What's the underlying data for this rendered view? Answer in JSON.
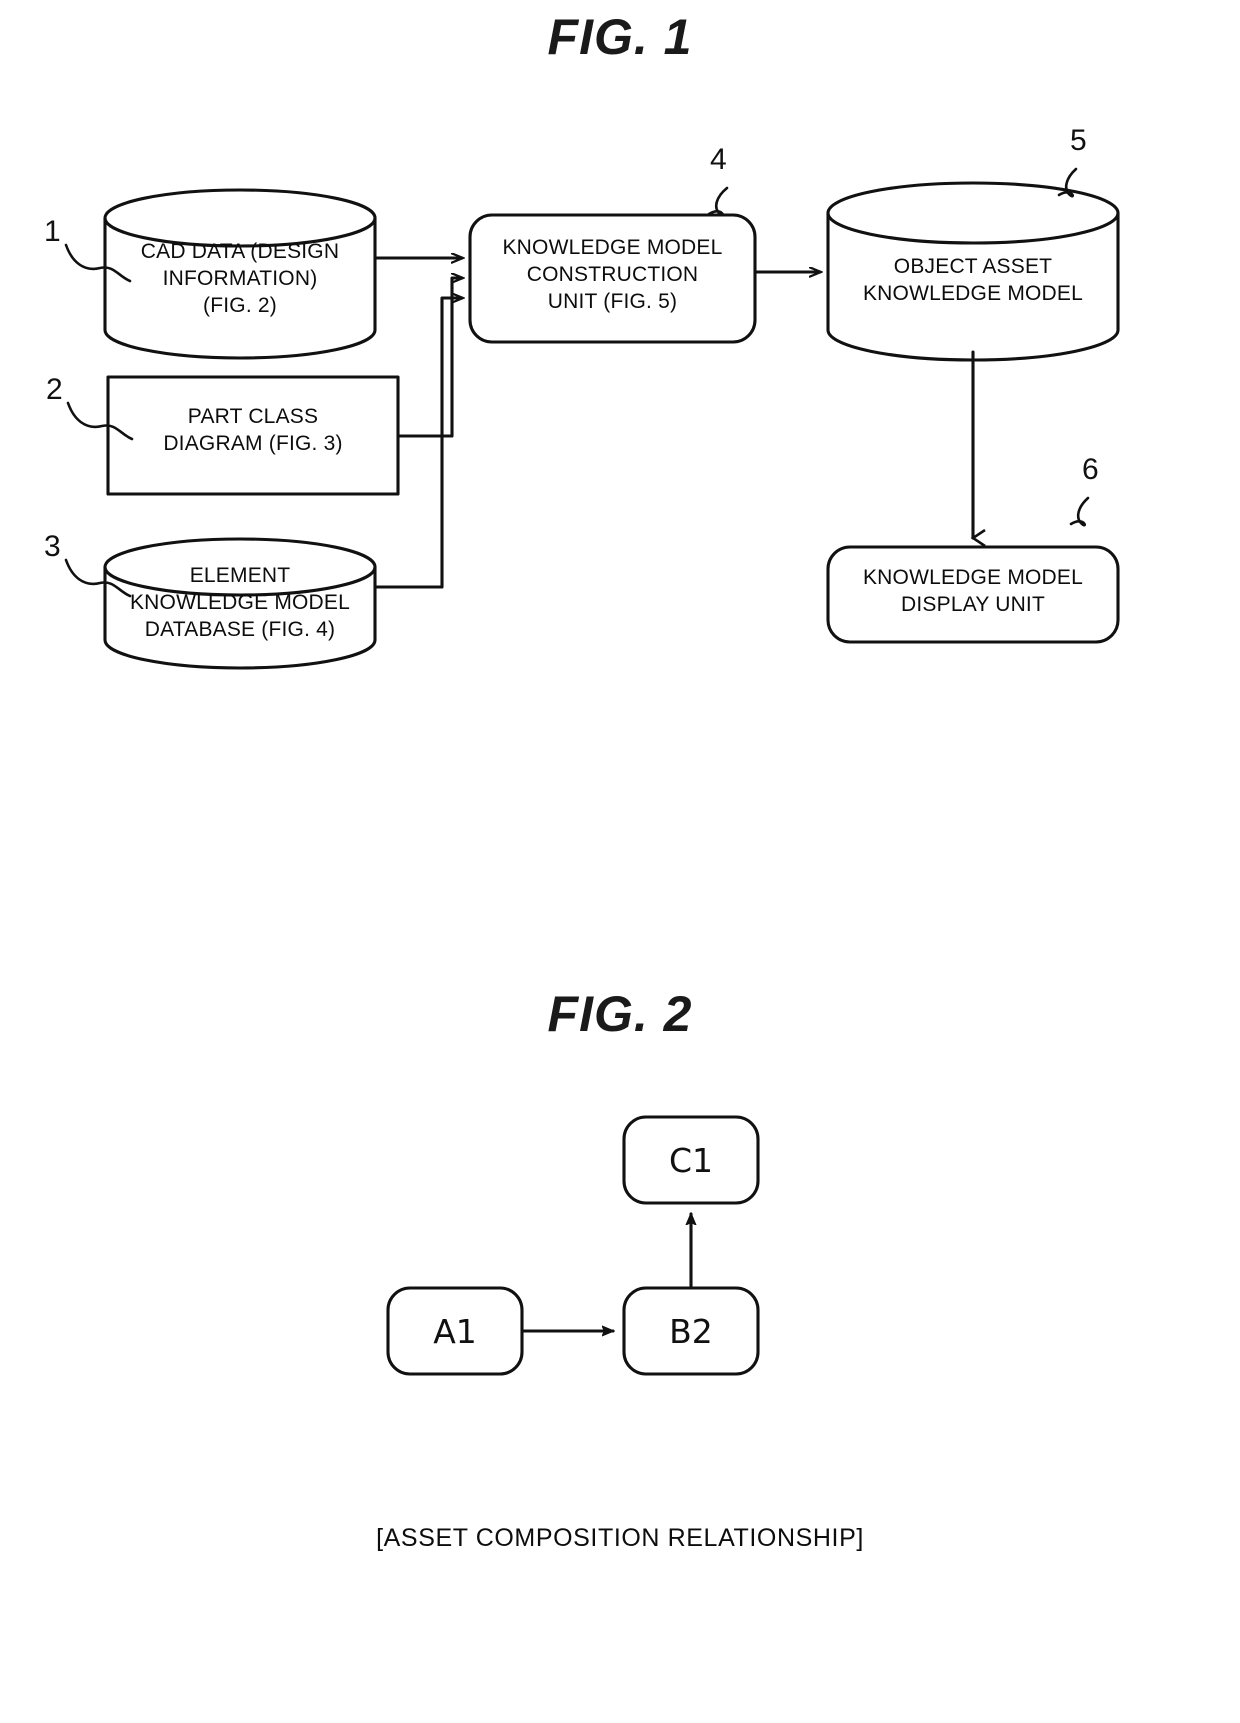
{
  "document": {
    "kind": "patent-drawing-sheet",
    "background_color": "#ffffff",
    "line_color": "#111111"
  },
  "figures": [
    {
      "id": "fig1",
      "title": "FIG. 1",
      "nodes": [
        {
          "id": "cad-data",
          "ref": "1",
          "shape": "cylinder",
          "label": "CAD DATA (DESIGN\nINFORMATION)\n(FIG. 2)"
        },
        {
          "id": "part-class-diagram",
          "ref": "2",
          "shape": "rectangle",
          "label": "PART CLASS\nDIAGRAM (FIG. 3)"
        },
        {
          "id": "element-knowledge-model-database",
          "ref": "3",
          "shape": "cylinder",
          "label": "ELEMENT\nKNOWLEDGE MODEL\nDATABASE (FIG. 4)"
        },
        {
          "id": "knowledge-model-construction-unit",
          "ref": "4",
          "shape": "rounded-rectangle",
          "label": "KNOWLEDGE MODEL\nCONSTRUCTION\nUNIT (FIG. 5)"
        },
        {
          "id": "object-asset-knowledge-model",
          "ref": "5",
          "shape": "cylinder",
          "label": "OBJECT ASSET\nKNOWLEDGE MODEL"
        },
        {
          "id": "knowledge-model-display-unit",
          "ref": "6",
          "shape": "rounded-rectangle",
          "label": "KNOWLEDGE MODEL\nDISPLAY UNIT"
        }
      ],
      "edges": [
        {
          "from": "cad-data",
          "to": "knowledge-model-construction-unit",
          "style": "orthogonal-arrow"
        },
        {
          "from": "part-class-diagram",
          "to": "knowledge-model-construction-unit",
          "style": "orthogonal-arrow"
        },
        {
          "from": "element-knowledge-model-database",
          "to": "knowledge-model-construction-unit",
          "style": "orthogonal-arrow"
        },
        {
          "from": "knowledge-model-construction-unit",
          "to": "object-asset-knowledge-model",
          "style": "straight-arrow"
        },
        {
          "from": "object-asset-knowledge-model",
          "to": "knowledge-model-display-unit",
          "style": "straight-arrow"
        }
      ]
    },
    {
      "id": "fig2",
      "title": "FIG. 2",
      "caption": "[ASSET COMPOSITION RELATIONSHIP]",
      "nodes": [
        {
          "id": "node-c1",
          "shape": "rounded-rectangle",
          "label": "C1"
        },
        {
          "id": "node-a1",
          "shape": "rounded-rectangle",
          "label": "A1"
        },
        {
          "id": "node-b2",
          "shape": "rounded-rectangle",
          "label": "B2"
        }
      ],
      "edges": [
        {
          "from": "node-a1",
          "to": "node-b2",
          "style": "straight-arrow",
          "direction": "right"
        },
        {
          "from": "node-b2",
          "to": "node-c1",
          "style": "straight-arrow",
          "direction": "up"
        }
      ]
    }
  ]
}
